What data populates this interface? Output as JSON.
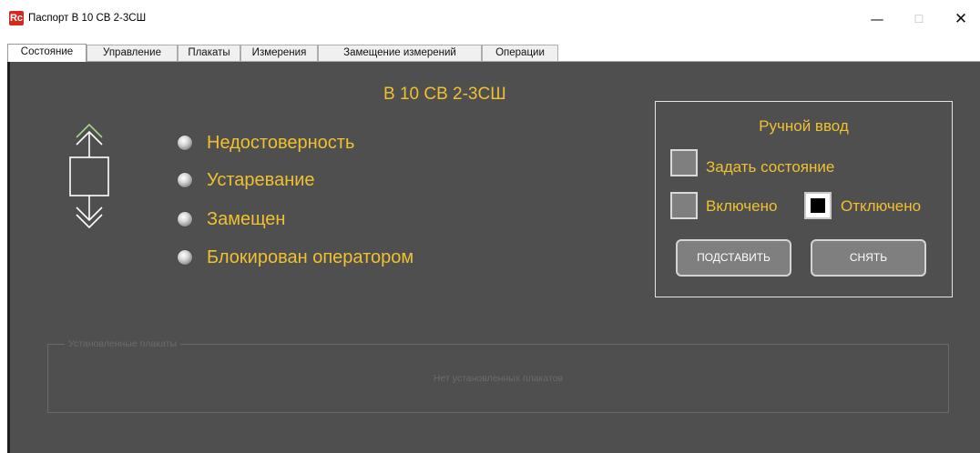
{
  "window": {
    "title": "Паспорт В 10 СВ 2-3СШ",
    "app_icon_text": "Rc",
    "minimize_glyph": "—",
    "maximize_glyph": "☐",
    "close_glyph": "✕"
  },
  "tabs": [
    {
      "label": "Состояние",
      "active": true
    },
    {
      "label": "Управление",
      "active": false
    },
    {
      "label": "Плакаты",
      "active": false
    },
    {
      "label": "Измерения",
      "active": false
    },
    {
      "label": "Замещение измерений",
      "active": false
    },
    {
      "label": "Операции",
      "active": false
    }
  ],
  "device": {
    "title": "В 10 СВ 2-3СШ",
    "symbol_icon": "breaker-symbol-icon"
  },
  "status_items": [
    {
      "label": "Недостоверность",
      "indicator": "off"
    },
    {
      "label": "Устаревание",
      "indicator": "off"
    },
    {
      "label": "Замещен",
      "indicator": "off"
    },
    {
      "label": "Блокирован оператором",
      "indicator": "off"
    }
  ],
  "manual_input": {
    "title": "Ручной ввод",
    "set_state": {
      "label": "Задать состояние",
      "checked": false
    },
    "on": {
      "label": "Включено",
      "checked": false
    },
    "off": {
      "label": "Отключено",
      "checked": true
    },
    "substitute_button": "ПОДСТАВИТЬ",
    "remove_button": "СНЯТЬ"
  },
  "posters": {
    "legend": "Установленные плакаты",
    "empty_text": "Нет установленных плакатов"
  },
  "colors": {
    "panel_background": "#4f4f4f",
    "accent_text": "#f0c030",
    "arrow_up": "#a9d18e",
    "arrow_down": "#ffffff"
  }
}
